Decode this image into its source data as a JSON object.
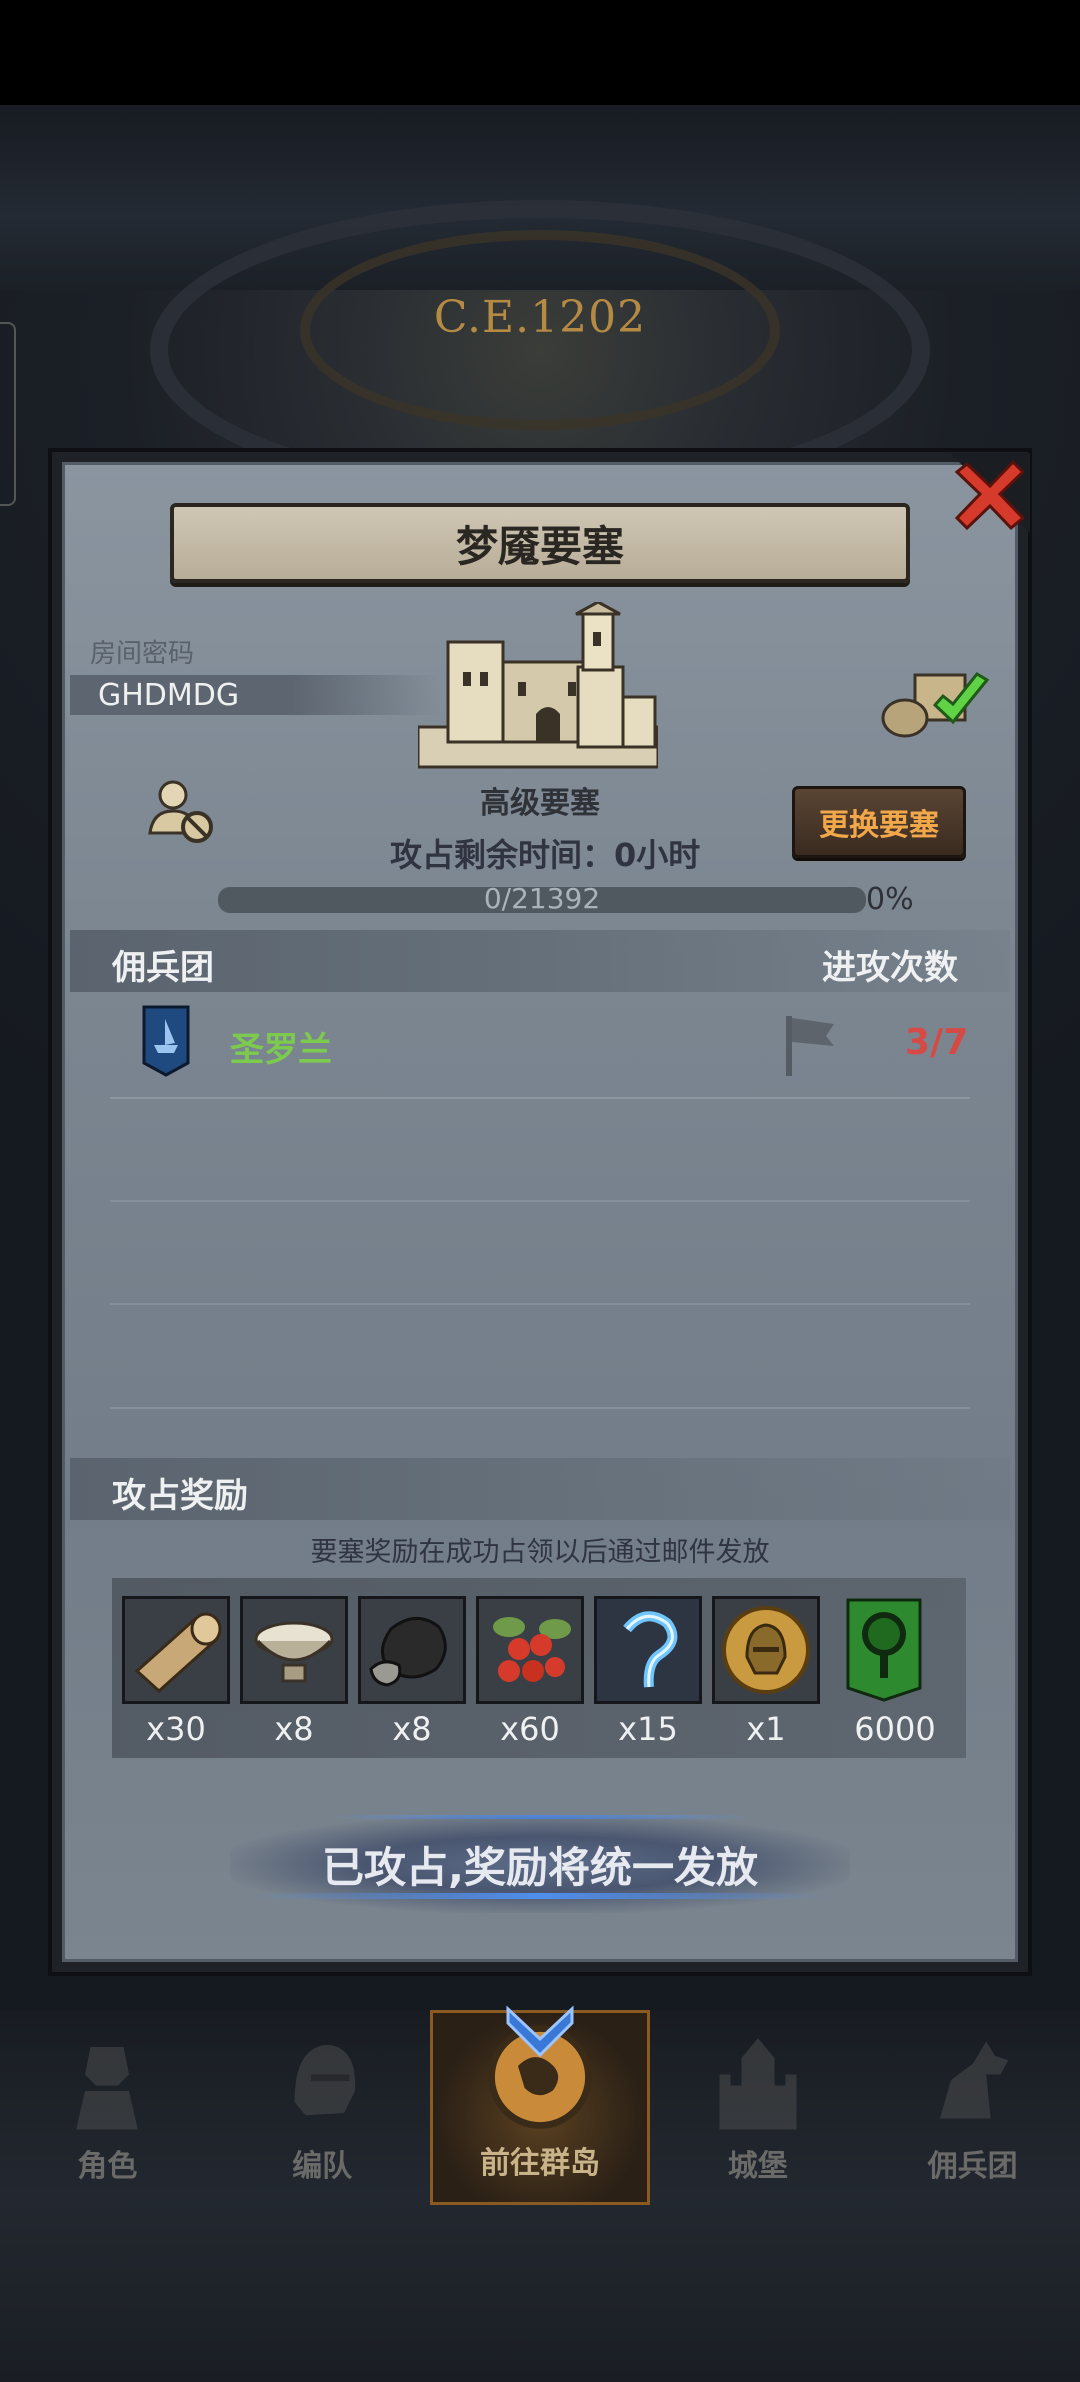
{
  "scene": {
    "year_label": "C.E.1202"
  },
  "dialog": {
    "title": "梦魇要塞",
    "room_label": "房间密码",
    "room_code": "GHDMDG",
    "fortress_grade": "高级要塞",
    "change_button": "更换要塞",
    "time_remaining": "攻占剩余时间：0小时",
    "progress_text": "0/21392",
    "progress_percent_label": "0%",
    "progress_value": 0,
    "mercenary_header": "佣兵团",
    "attacks_header": "进攻次数",
    "mercenaries": [
      {
        "name": "圣罗兰",
        "attacks": "3/7"
      }
    ],
    "reward_header": "攻占奖励",
    "reward_note": "要塞奖励在成功占领以后通过邮件发放",
    "rewards": [
      {
        "icon": "wood-log-icon",
        "qty": "x30"
      },
      {
        "icon": "bowl-icon",
        "qty": "x8"
      },
      {
        "icon": "ore-icon",
        "qty": "x8"
      },
      {
        "icon": "berries-icon",
        "qty": "x60"
      },
      {
        "icon": "magic-hook-icon",
        "qty": "x15"
      },
      {
        "icon": "knight-coin-icon",
        "qty": "x1"
      },
      {
        "icon": "tree-banner-icon",
        "qty": "6000"
      }
    ],
    "claim_button": "已攻占,奖励将统一发放"
  },
  "nav": [
    {
      "label": "角色",
      "icon": "knight-icon"
    },
    {
      "label": "编队",
      "icon": "helmet-icon"
    },
    {
      "label": "前往群岛",
      "icon": "world-map-icon",
      "active": true
    },
    {
      "label": "城堡",
      "icon": "castle-icon"
    },
    {
      "label": "佣兵团",
      "icon": "horse-icon"
    }
  ],
  "colors": {
    "panel": "#7d8792",
    "accent_orange": "#f0a84a",
    "mercenary_green": "#7ccb4e",
    "attack_red": "#d64a46",
    "close_red": "#d63a2a"
  }
}
